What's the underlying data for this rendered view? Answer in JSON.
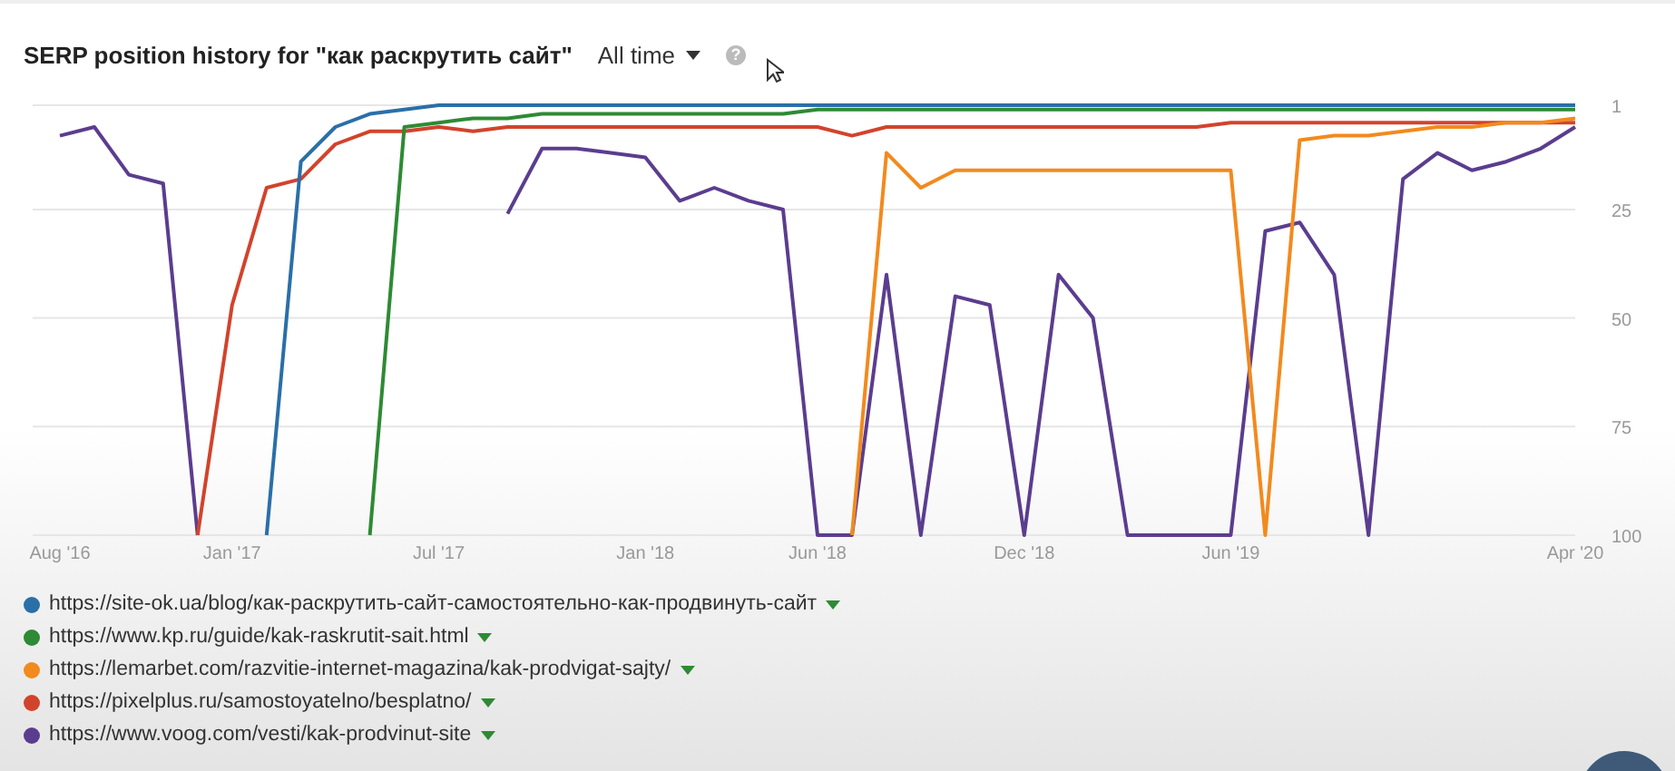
{
  "header": {
    "title": "SERP position history for \"как раскрутить сайт\"",
    "range": "All time",
    "help": "?"
  },
  "chart": {
    "chart_data": {
      "type": "line",
      "grid": true,
      "ylim": [
        100,
        1
      ],
      "yticks": [
        1,
        25,
        50,
        75,
        100
      ],
      "categories": [
        "Aug '16",
        null,
        null,
        null,
        null,
        "Jan '17",
        null,
        null,
        null,
        null,
        null,
        "Jul '17",
        null,
        null,
        null,
        null,
        null,
        "Jan '18",
        null,
        null,
        null,
        null,
        "Jun '18",
        null,
        null,
        null,
        null,
        null,
        "Dec '18",
        null,
        null,
        null,
        null,
        null,
        "Jun '19",
        null,
        null,
        null,
        null,
        null,
        null,
        null,
        null,
        null,
        "Apr '20"
      ],
      "series": [
        {
          "name": "https://site-ok.ua/blog/как-раскрутить-сайт-самостоятельно-как-продвинуть-сайт",
          "color": "#2a6fa8",
          "values": [
            null,
            null,
            null,
            null,
            null,
            null,
            100,
            14,
            6,
            3,
            2,
            1,
            1,
            1,
            1,
            1,
            1,
            1,
            1,
            1,
            1,
            1,
            1,
            1,
            1,
            1,
            1,
            1,
            1,
            1,
            1,
            1,
            1,
            1,
            1,
            1,
            1,
            1,
            1,
            1,
            1,
            1,
            1,
            1,
            1
          ]
        },
        {
          "name": "https://www.kp.ru/guide/kak-raskrutit-sait.html",
          "color": "#2e8a34",
          "values": [
            null,
            null,
            null,
            null,
            null,
            null,
            null,
            null,
            null,
            100,
            6,
            5,
            4,
            4,
            3,
            3,
            3,
            3,
            3,
            3,
            3,
            3,
            2,
            2,
            2,
            2,
            2,
            2,
            2,
            2,
            2,
            2,
            2,
            2,
            2,
            2,
            2,
            2,
            2,
            2,
            2,
            2,
            2,
            2,
            2
          ]
        },
        {
          "name": "https://lemarbet.com/razvitie-internet-magazina/kak-prodvigat-sajty/",
          "color": "#f28a1e",
          "values": [
            null,
            null,
            null,
            null,
            null,
            null,
            null,
            null,
            null,
            null,
            null,
            null,
            null,
            null,
            null,
            null,
            null,
            null,
            null,
            null,
            null,
            null,
            null,
            100,
            12,
            20,
            16,
            16,
            16,
            16,
            16,
            16,
            16,
            16,
            16,
            100,
            9,
            8,
            8,
            7,
            6,
            6,
            5,
            5,
            4
          ]
        },
        {
          "name": "https://pixelplus.ru/samostoyatelno/besplatno/",
          "color": "#d2432c",
          "values": [
            null,
            null,
            null,
            null,
            100,
            47,
            20,
            18,
            10,
            7,
            7,
            6,
            7,
            6,
            6,
            6,
            6,
            6,
            6,
            6,
            6,
            6,
            6,
            8,
            6,
            6,
            6,
            6,
            6,
            6,
            6,
            6,
            6,
            6,
            5,
            5,
            5,
            5,
            5,
            5,
            5,
            5,
            5,
            5,
            5
          ]
        },
        {
          "name": "https://www.voog.com/vesti/kak-prodvinut-site",
          "color": "#5b3d8f",
          "values": [
            8,
            6,
            17,
            19,
            100,
            null,
            null,
            null,
            null,
            null,
            null,
            null,
            null,
            26,
            11,
            11,
            12,
            13,
            23,
            20,
            23,
            25,
            100,
            100,
            40,
            100,
            45,
            47,
            100,
            40,
            50,
            100,
            100,
            100,
            100,
            30,
            28,
            40,
            100,
            18,
            12,
            16,
            14,
            11,
            6
          ]
        }
      ]
    }
  }
}
